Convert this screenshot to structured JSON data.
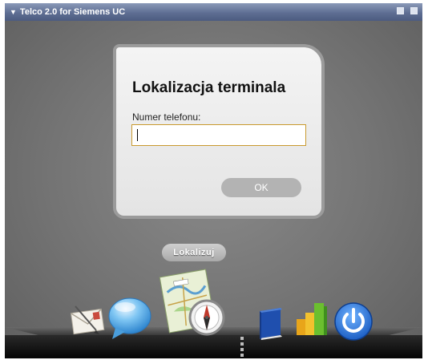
{
  "window": {
    "title": "Telco 2.0 for Siemens UC",
    "collapse_glyph": "▼"
  },
  "dialog": {
    "title": "Lokalizacja terminala",
    "field_label": "Numer telefonu:",
    "phone_value": "",
    "ok_label": "OK"
  },
  "actions": {
    "localize_label": "Lokalizuj"
  },
  "dock": {
    "items": [
      {
        "name": "mail-icon"
      },
      {
        "name": "chat-bubble-icon"
      },
      {
        "name": "map-compass-icon"
      },
      {
        "name": "book-icon"
      },
      {
        "name": "bar-chart-icon"
      },
      {
        "name": "power-icon"
      }
    ]
  },
  "colors": {
    "titlebar": "#5e6e93",
    "input_border": "#c99a2e",
    "power_blue": "#1d5fc4",
    "book_blue": "#1f4fae"
  }
}
